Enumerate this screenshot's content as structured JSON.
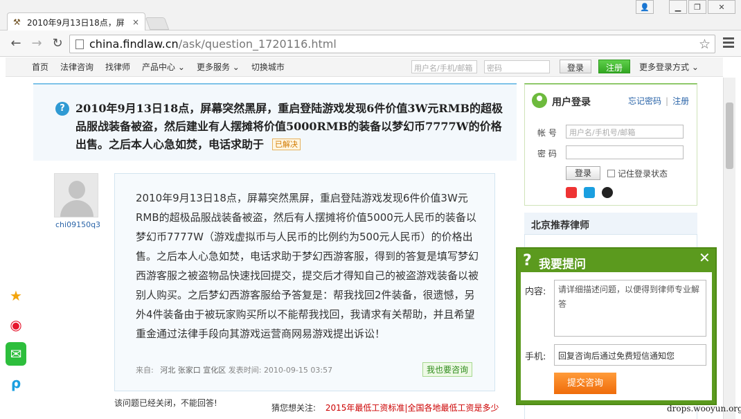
{
  "browser": {
    "tab_title": "2010年9月13日18点，屏",
    "tab_close": "×",
    "url_domain": "china.findlaw.cn",
    "url_path": "/ask/question_1720116.html",
    "back_icon": "arrow-left-icon",
    "forward_icon": "arrow-right-icon",
    "reload_icon": "reload-icon",
    "star_icon": "star-icon",
    "menu_icon": "hamburger-icon"
  },
  "site_nav": {
    "links": [
      "首页",
      "法律咨询",
      "找律师",
      "产品中心",
      "更多服务",
      "切换城市"
    ],
    "username_placeholder": "用户名/手机/邮箱",
    "password_placeholder": "密码",
    "login_label": "登录",
    "register_label": "注册",
    "more_login_label": "更多登录方式"
  },
  "question": {
    "title": "2010年9月13日18点，屏幕突然黑屏，重启登陆游戏发现6件价值3W元RMB的超极品服战装备被盗，然后建业有人摆摊将价值5000RMB的装备以梦幻币7777W的价格出售。之后本人心急如焚，电话求助于",
    "solved_badge": "已解决",
    "asker_name": "chi09150q3",
    "detail": "2010年9月13日18点，屏幕突然黑屏，重启登陆游戏发现6件价值3W元RMB的超极品服战装备被盗，然后有人摆摊将价值5000元人民币的装备以梦幻币7777W（游戏虚拟币与人民币的比例约为500元人民币）的价格出售。之后本人心急如焚，电话求助于梦幻西游客服，得到的答复是填写梦幻西游客服之被盗物品快速找回提交，提交后才得知自己的被盗游戏装备以被别人购买。之后梦幻西游客服给予答复是：帮我找回2件装备，很遗憾，另外4件装备由于被玩家购买所以不能帮我找回，我请求有关帮助，并且希望重金通过法律手段向其游戏运营商网易游戏提出诉讼！",
    "meta_from_label": "来自:",
    "meta_location": "河北 张家口 宣化区",
    "meta_time_label": "发表时间:",
    "meta_time": "2010-09-15 03:57",
    "ask_too_label": "我也要咨询",
    "closed_note": "该问题已经关闭，不能回答!",
    "guess_label": "猜您想关注:",
    "guess_link": "2015年最低工资标准|全国各地最低工资是多少"
  },
  "login_panel": {
    "title": "用户登录",
    "forgot_label": "忘记密码",
    "register_label": "注册",
    "account_label": "帐  号",
    "account_placeholder": "用户名/手机号/邮箱",
    "password_label": "密  码",
    "login_label": "登录",
    "remember_label": "记住登录状态"
  },
  "lawyer_panel": {
    "title": "北京推荐律师"
  },
  "ask_widget": {
    "title": "我要提问",
    "content_label": "内容:",
    "content_placeholder": "请详细描述问题，以便得到律师专业解答",
    "phone_label": "手机:",
    "phone_placeholder": "回复咨询后通过免费短信通知您",
    "submit_label": "提交咨询"
  },
  "watermark": "drops.wooyun.org",
  "colors": {
    "accent_green": "#5b9a1e",
    "link_blue": "#2a64a8",
    "orange": "#ef6c0a"
  }
}
